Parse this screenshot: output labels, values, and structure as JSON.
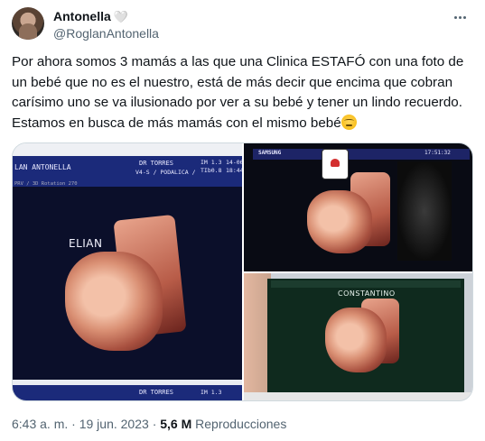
{
  "author": {
    "display_name": "Antonella",
    "heart": "🤍",
    "handle": "@RoglanAntonella"
  },
  "tweet": {
    "text": "Por ahora somos 3 mamás a las que una Clinica ESTAFÓ con una foto de un bebé que no es el nuestro, está de más decir que encima que cobran carísimo uno se va ilusionado por ver a su bebé y tener un lindo recuerdo. Estamos en busca de más mamás con el mismo bebé"
  },
  "media": {
    "left_photo": {
      "header_left": "LAN ANTONELLA",
      "header_mid_1": "DR TORRES",
      "header_mid_2": "V4-S / PODALICA /",
      "header_right_1": "IM 1.3",
      "header_right_2": "TIb0.8",
      "header_right_3": "14-06",
      "header_right_4": "18:44",
      "sub_header": "PRV / 3D Rotation 270",
      "name_label": "ELIAN",
      "footer_mid": "DR TORRES",
      "footer_right": "IM 1.3"
    },
    "top_right_photo": {
      "brand": "SAMSUNG",
      "header_right": "17:51:32"
    },
    "bottom_right_photo": {
      "name_label": "CONSTANTINO"
    }
  },
  "meta": {
    "time": "6:43 a. m.",
    "separator": "·",
    "date": "19 jun. 2023",
    "views_count": "5,6 M",
    "views_label": "Reproducciones"
  }
}
